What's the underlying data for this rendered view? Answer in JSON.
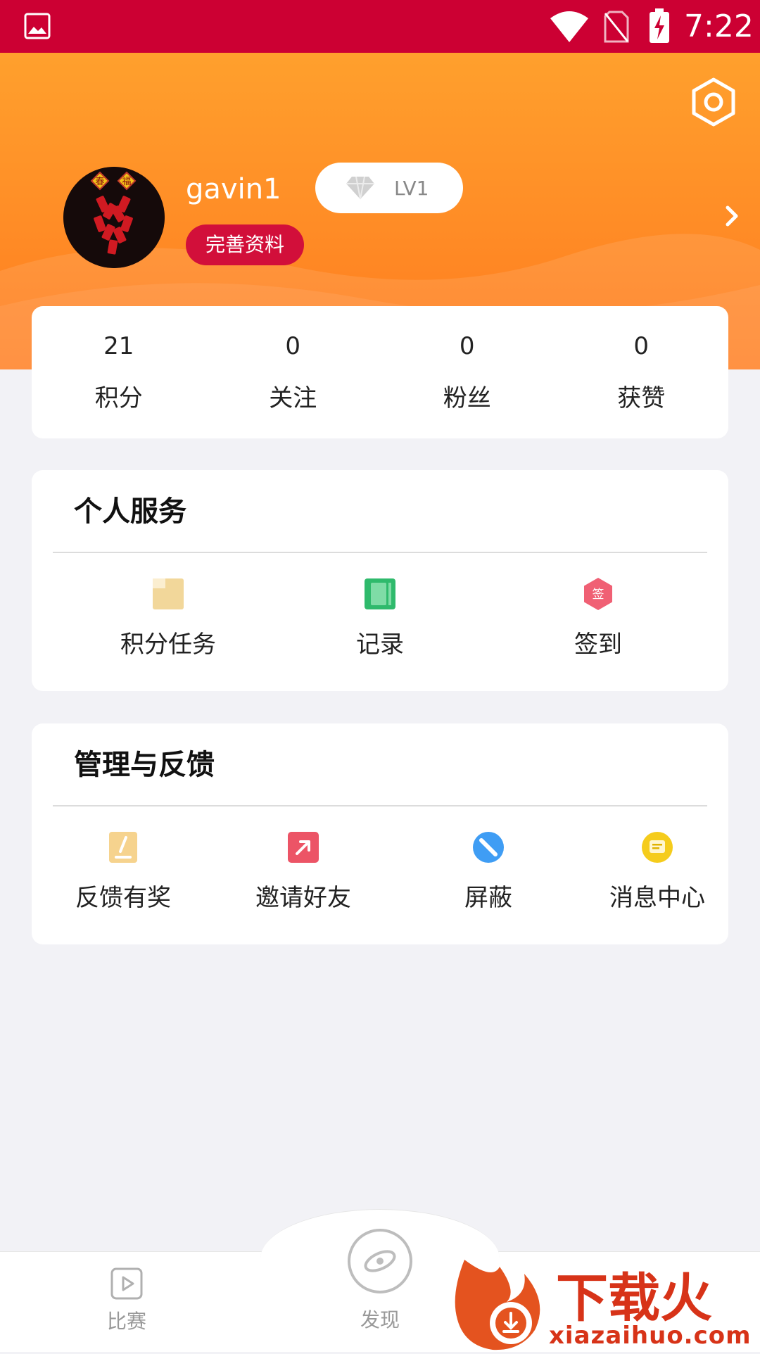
{
  "status_bar": {
    "time": "7:22",
    "icons": [
      "gallery-icon",
      "wifi-icon",
      "no-sim-icon",
      "battery-charging-icon"
    ]
  },
  "profile": {
    "username": "gavin1",
    "level": "LV1",
    "complete_profile_label": "完善资料",
    "avatar_text": [
      "春",
      "福"
    ]
  },
  "stats": [
    {
      "value": "21",
      "label": "积分"
    },
    {
      "value": "0",
      "label": "关注"
    },
    {
      "value": "0",
      "label": "粉丝"
    },
    {
      "value": "0",
      "label": "获赞"
    }
  ],
  "personal_services": {
    "title": "个人服务",
    "items": [
      {
        "label": "积分任务",
        "icon": "points-task-icon"
      },
      {
        "label": "记录",
        "icon": "record-icon"
      },
      {
        "label": "签到",
        "icon": "sign-in-icon",
        "icon_text": "签"
      }
    ]
  },
  "management": {
    "title": "管理与反馈",
    "items": [
      {
        "label": "反馈有奖",
        "icon": "feedback-icon"
      },
      {
        "label": "邀请好友",
        "icon": "invite-icon"
      },
      {
        "label": "屏蔽",
        "icon": "block-icon"
      },
      {
        "label": "消息中心",
        "icon": "message-icon"
      }
    ]
  },
  "bottom_nav": {
    "tabs": [
      {
        "label": "比赛",
        "icon": "play-icon"
      },
      {
        "label": "发现",
        "icon": "discover-icon"
      }
    ]
  },
  "watermark": {
    "text": "下载火",
    "url_text": "xiazaihuo.com"
  },
  "colors": {
    "status_bar": "#cc0033",
    "hero_top": "#ffa02d",
    "hero_bottom": "#ff7b1e",
    "accent_red": "#d20f3a",
    "background": "#f2f2f6"
  }
}
